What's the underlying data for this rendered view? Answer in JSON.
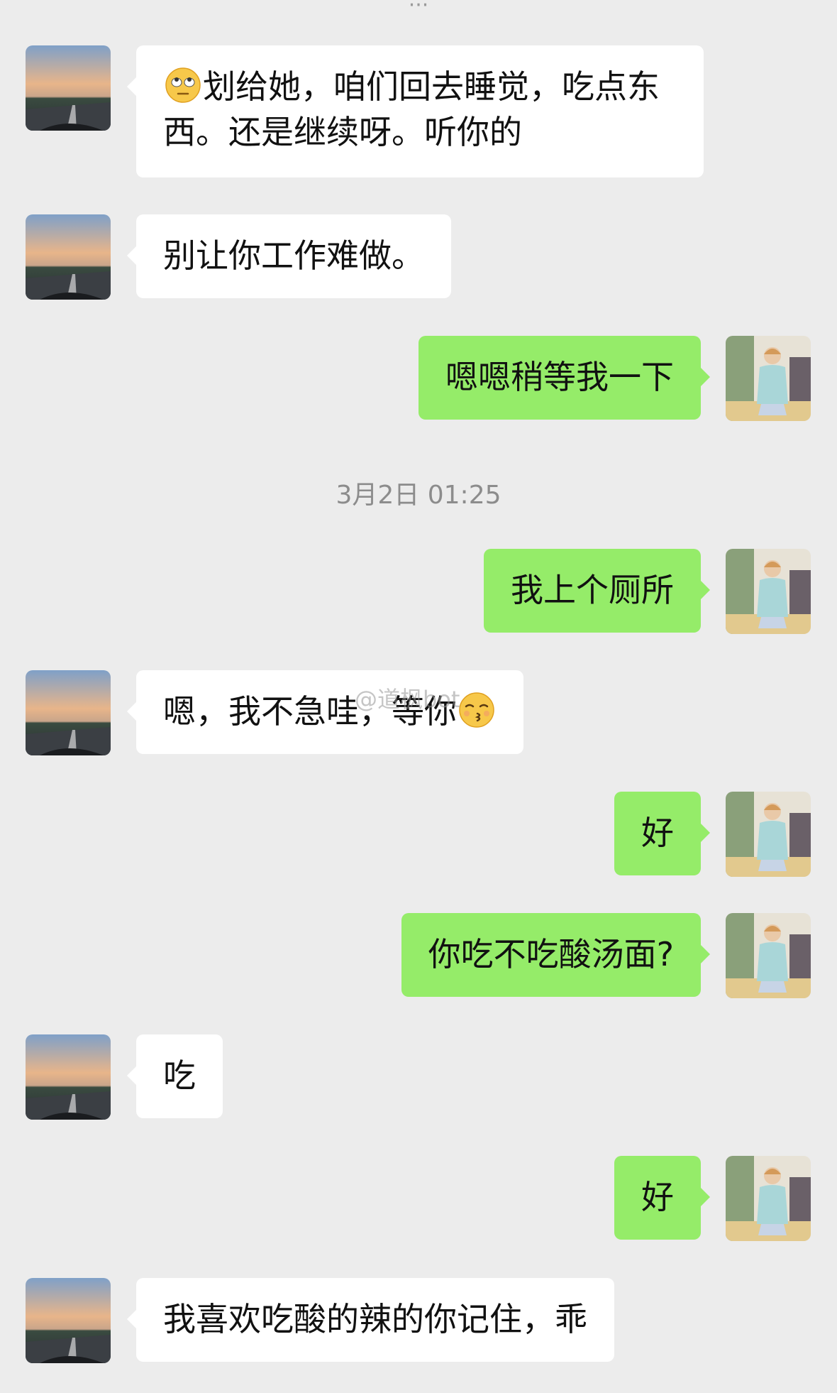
{
  "top_partial_text": "···",
  "timestamp": "3月2日 01:25",
  "watermark": "@道枫bot",
  "colors": {
    "background": "#ececec",
    "incoming_bubble": "#ffffff",
    "outgoing_bubble": "#95ec69",
    "timestamp": "#8c8c8c"
  },
  "messages": [
    {
      "side": "left",
      "emoji_before": "rolling-eyes-emoji",
      "line1": "划给她，咱们回去睡觉，吃点东",
      "line2": "西。还是继续呀。听你的"
    },
    {
      "side": "left",
      "text": "别让你工作难做。"
    },
    {
      "side": "right",
      "text": "嗯嗯稍等我一下"
    },
    {
      "side": "right",
      "text": "我上个厕所"
    },
    {
      "side": "left",
      "text": "嗯，我不急哇，等你",
      "emoji_after": "kissing-emoji"
    },
    {
      "side": "right",
      "text": "好"
    },
    {
      "side": "right",
      "text": "你吃不吃酸汤面?"
    },
    {
      "side": "left",
      "text": "吃"
    },
    {
      "side": "right",
      "text": "好"
    },
    {
      "side": "left",
      "text": "我喜欢吃酸的辣的你记住，乖"
    }
  ]
}
